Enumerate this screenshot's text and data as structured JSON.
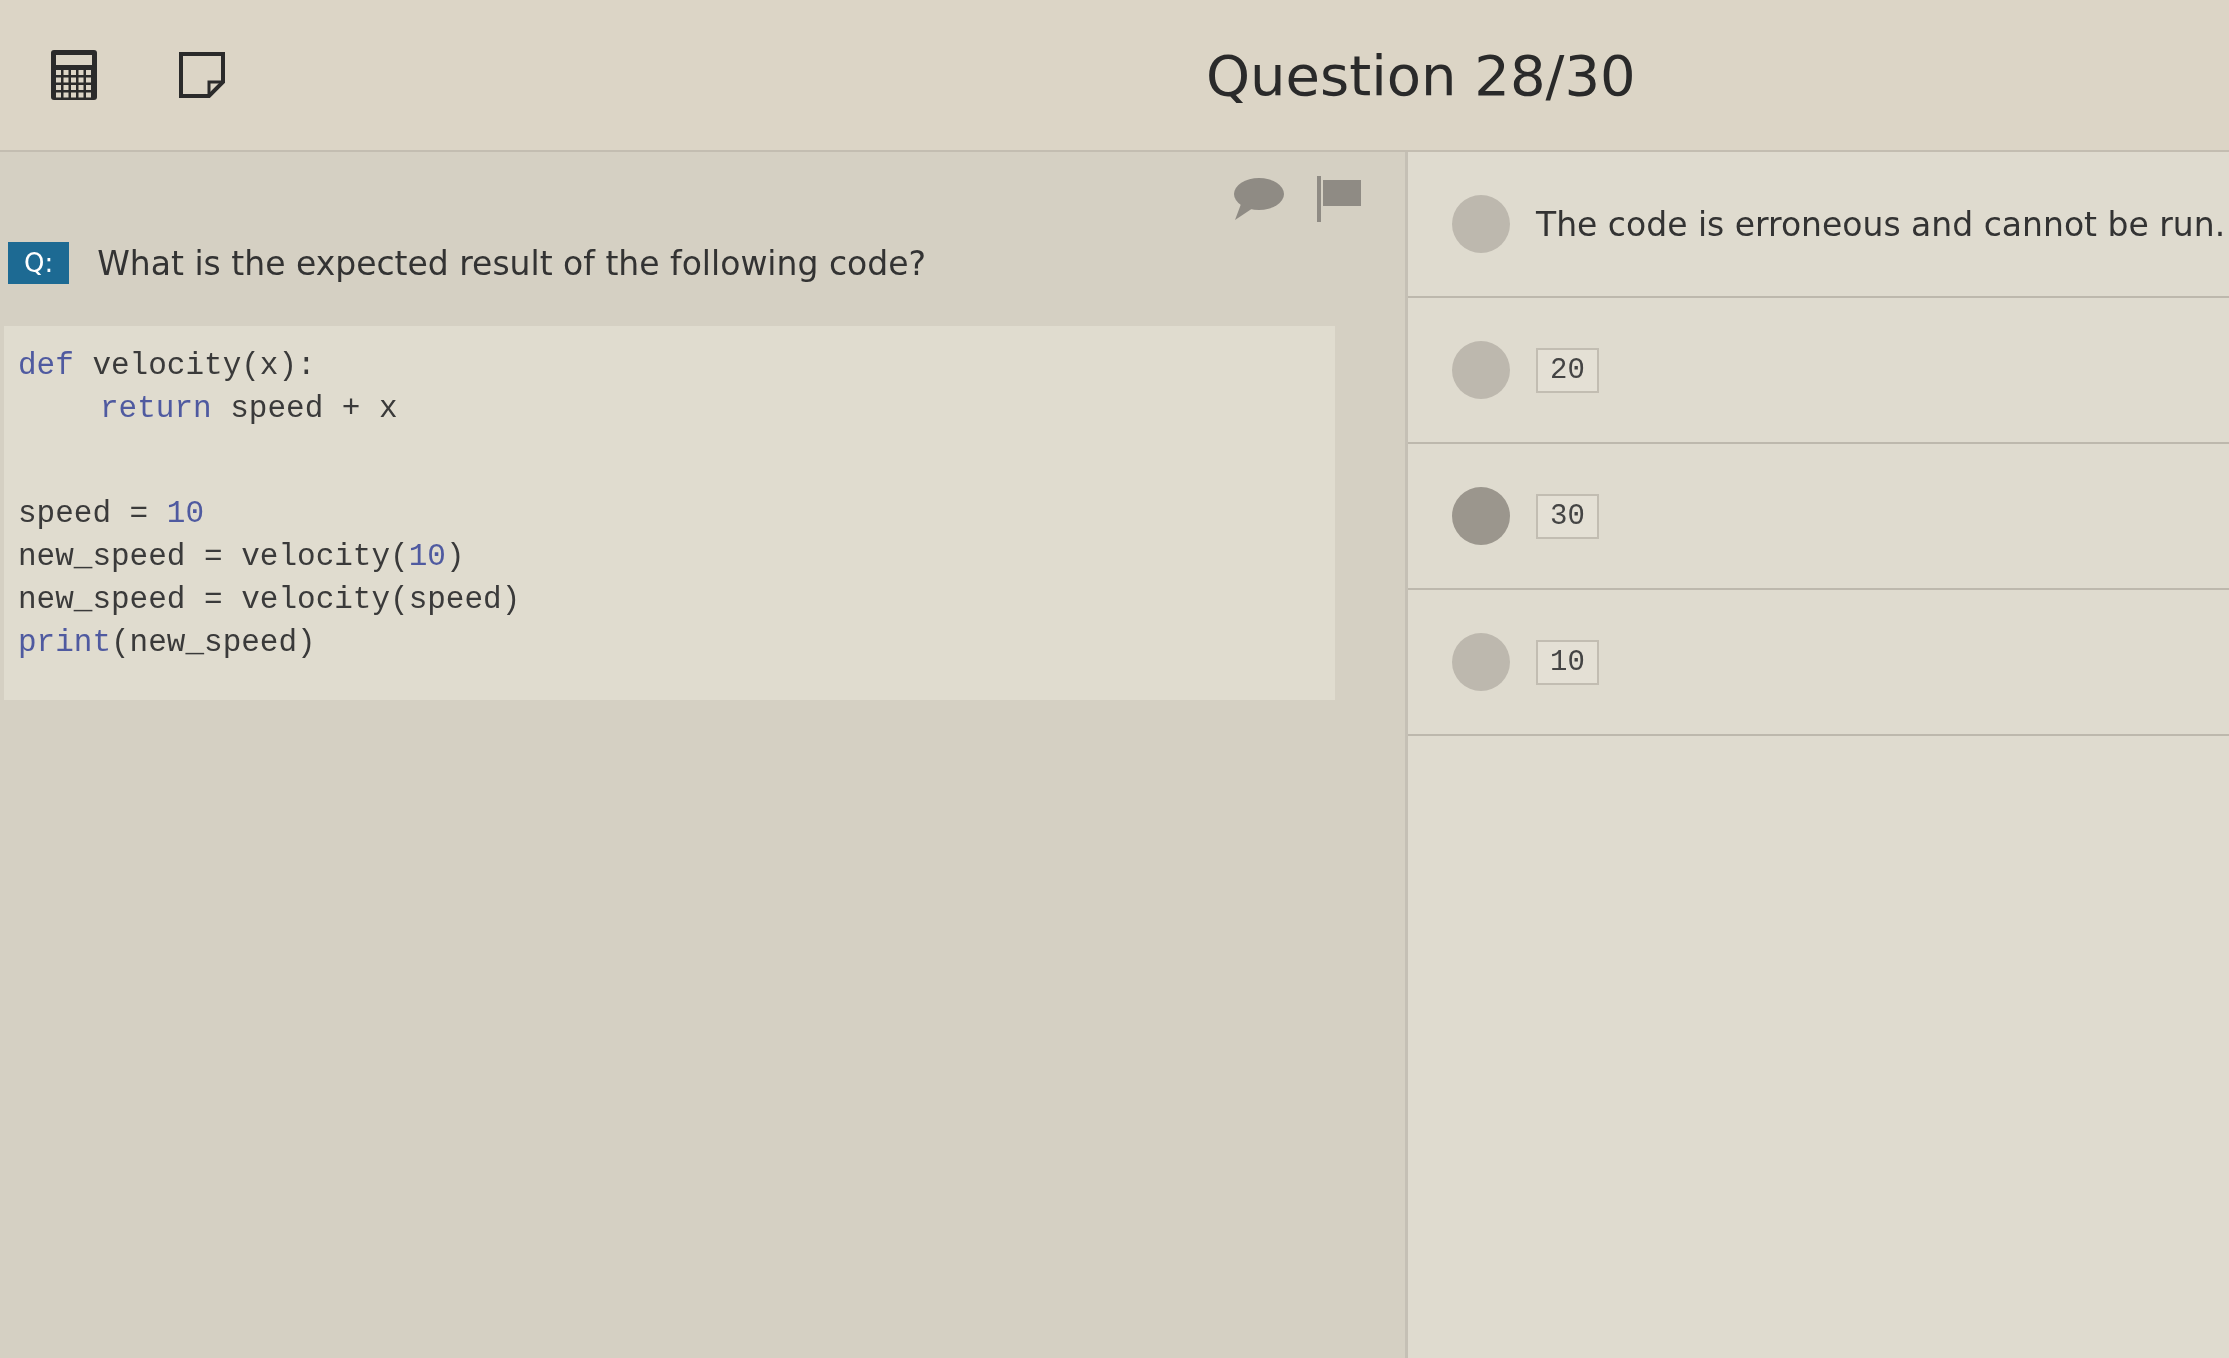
{
  "header": {
    "title": "Question 28/30"
  },
  "question": {
    "badge": "Q:",
    "text": "What is the expected result of the following code?"
  },
  "code_blocks": [
    [
      {
        "indented": false,
        "tokens": [
          {
            "kind": "keyword",
            "text": "def"
          },
          {
            "kind": "plain",
            "text": " velocity(x):"
          }
        ]
      },
      {
        "indented": true,
        "tokens": [
          {
            "kind": "keyword",
            "text": "return"
          },
          {
            "kind": "plain",
            "text": " speed + x"
          }
        ]
      }
    ],
    [
      {
        "indented": false,
        "tokens": [
          {
            "kind": "plain",
            "text": "speed = "
          },
          {
            "kind": "number",
            "text": "10"
          }
        ]
      },
      {
        "indented": false,
        "tokens": [
          {
            "kind": "plain",
            "text": "new_speed = velocity("
          },
          {
            "kind": "number",
            "text": "10"
          },
          {
            "kind": "plain",
            "text": ")"
          }
        ]
      },
      {
        "indented": false,
        "tokens": [
          {
            "kind": "plain",
            "text": "new_speed = velocity(speed)"
          }
        ]
      },
      {
        "indented": false,
        "tokens": [
          {
            "kind": "keyword",
            "text": "print"
          },
          {
            "kind": "plain",
            "text": "(new_speed)"
          }
        ]
      }
    ]
  ],
  "options": [
    {
      "kind": "text",
      "label": "The code is erroneous and cannot be run.",
      "selected": false
    },
    {
      "kind": "code",
      "label": "20",
      "selected": false
    },
    {
      "kind": "code",
      "label": "30",
      "selected": true
    },
    {
      "kind": "code",
      "label": "10",
      "selected": false
    }
  ]
}
